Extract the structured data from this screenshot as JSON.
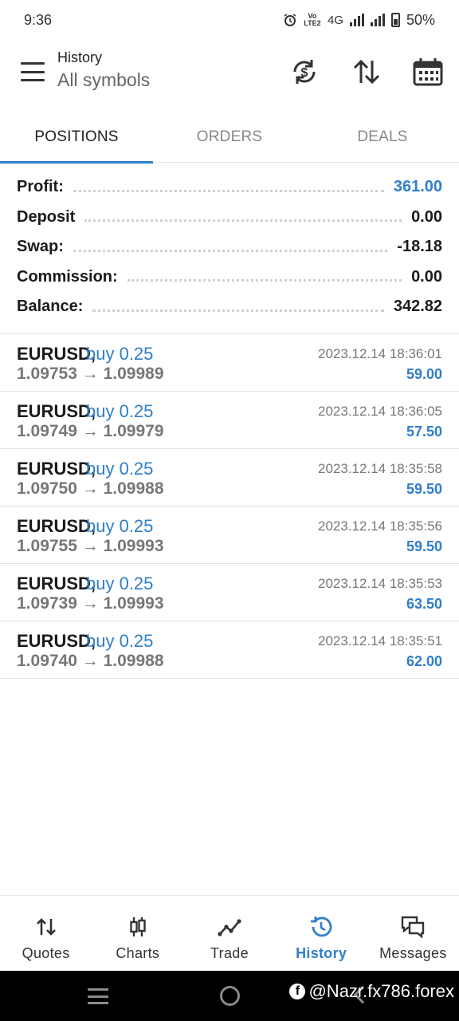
{
  "status_bar": {
    "time": "9:36",
    "network_label": "4G",
    "volte_label": "Vo LTE2",
    "battery": "50%"
  },
  "header": {
    "title": "History",
    "subtitle": "All symbols",
    "icons": [
      "currency-exchange-icon",
      "sort-icon",
      "calendar-icon"
    ]
  },
  "tabs": [
    {
      "label": "POSITIONS",
      "active": true
    },
    {
      "label": "ORDERS",
      "active": false
    },
    {
      "label": "DEALS",
      "active": false
    }
  ],
  "summary": [
    {
      "label": "Profit:",
      "value": "361.00",
      "highlight": true
    },
    {
      "label": "Deposit",
      "value": "0.00",
      "highlight": false
    },
    {
      "label": "Swap:",
      "value": "-18.18",
      "highlight": false
    },
    {
      "label": "Commission:",
      "value": "0.00",
      "highlight": false
    },
    {
      "label": "Balance:",
      "value": "342.82",
      "highlight": false
    }
  ],
  "positions": [
    {
      "symbol": "EURUSD,",
      "side": "buy 0.25",
      "open": "1.09753",
      "arrow": "→",
      "close": "1.09989",
      "time": "2023.12.14 18:36:01",
      "profit": "59.00"
    },
    {
      "symbol": "EURUSD,",
      "side": "buy 0.25",
      "open": "1.09749",
      "arrow": "→",
      "close": "1.09979",
      "time": "2023.12.14 18:36:05",
      "profit": "57.50"
    },
    {
      "symbol": "EURUSD,",
      "side": "buy 0.25",
      "open": "1.09750",
      "arrow": "→",
      "close": "1.09988",
      "time": "2023.12.14 18:35:58",
      "profit": "59.50"
    },
    {
      "symbol": "EURUSD,",
      "side": "buy 0.25",
      "open": "1.09755",
      "arrow": "→",
      "close": "1.09993",
      "time": "2023.12.14 18:35:56",
      "profit": "59.50"
    },
    {
      "symbol": "EURUSD,",
      "side": "buy 0.25",
      "open": "1.09739",
      "arrow": "→",
      "close": "1.09993",
      "time": "2023.12.14 18:35:53",
      "profit": "63.50"
    },
    {
      "symbol": "EURUSD,",
      "side": "buy 0.25",
      "open": "1.09740",
      "arrow": "→",
      "close": "1.09988",
      "time": "2023.12.14 18:35:51",
      "profit": "62.00"
    }
  ],
  "bottom_nav": [
    {
      "label": "Quotes",
      "icon": "quotes-icon",
      "active": false
    },
    {
      "label": "Charts",
      "icon": "candlestick-icon",
      "active": false
    },
    {
      "label": "Trade",
      "icon": "trend-line-icon",
      "active": false
    },
    {
      "label": "History",
      "icon": "history-clock-icon",
      "active": true
    },
    {
      "label": "Messages",
      "icon": "messages-icon",
      "active": false
    }
  ],
  "watermark": {
    "text": "@Nazr.fx786.forex"
  },
  "colors": {
    "accent": "#2f7fc8",
    "text": "#1b1b1b",
    "muted": "#777777"
  }
}
